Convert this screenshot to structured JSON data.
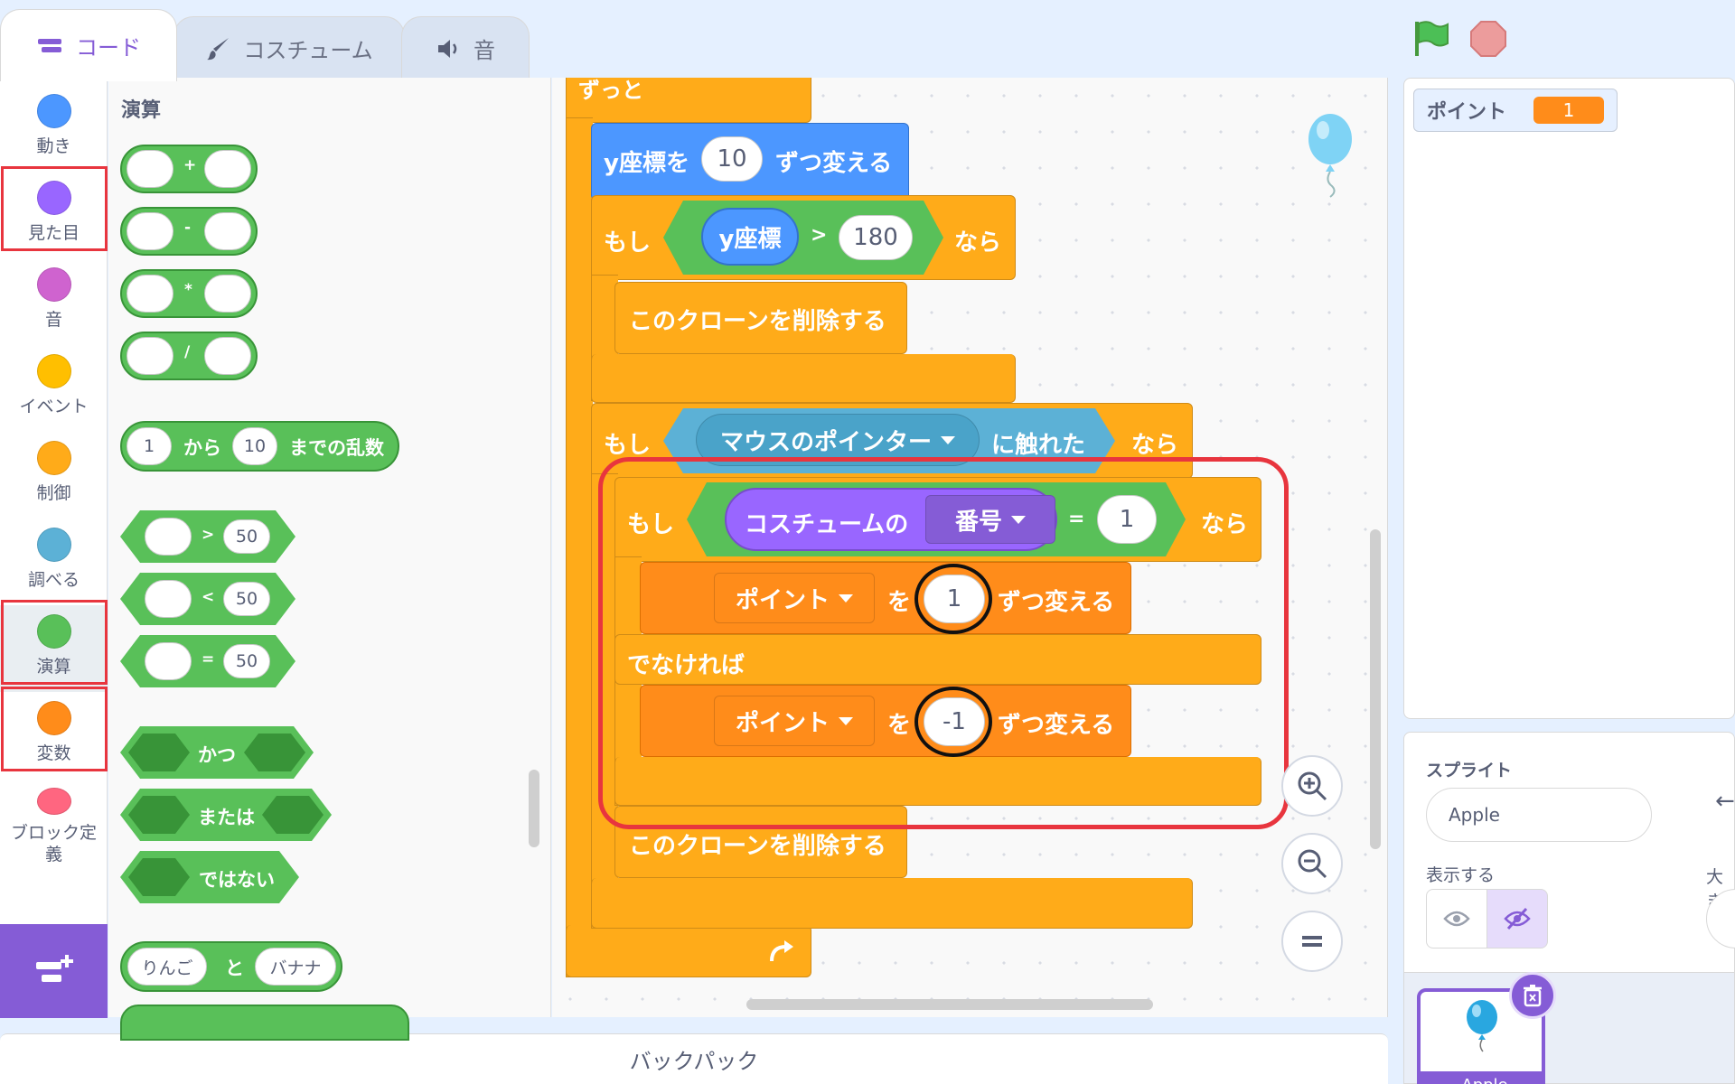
{
  "tabs": [
    {
      "label": "コード",
      "icon": "code-icon",
      "active": true
    },
    {
      "label": "コスチューム",
      "icon": "brush-icon",
      "active": false
    },
    {
      "label": "音",
      "icon": "speaker-icon",
      "active": false
    }
  ],
  "controls": {
    "green_flag": "green-flag-icon",
    "stop": "stop-icon"
  },
  "categories": [
    {
      "label": "動き",
      "color": "#4c97ff"
    },
    {
      "label": "見た目",
      "color": "#9966ff"
    },
    {
      "label": "音",
      "color": "#cf63cf"
    },
    {
      "label": "イベント",
      "color": "#ffbf00"
    },
    {
      "label": "制御",
      "color": "#ffab19"
    },
    {
      "label": "調べる",
      "color": "#5cb1d6"
    },
    {
      "label": "演算",
      "color": "#59c059"
    },
    {
      "label": "変数",
      "color": "#ff8c1a"
    },
    {
      "label": "ブロック定義",
      "color": "#ff6680"
    }
  ],
  "palette": {
    "title": "演算",
    "ops": [
      "+",
      "-",
      "*",
      "/"
    ],
    "random": {
      "from": "1",
      "word_from": "から",
      "to": "10",
      "word_to": "までの乱数"
    },
    "compare": [
      {
        "op": ">",
        "value": "50"
      },
      {
        "op": "<",
        "value": "50"
      },
      {
        "op": "=",
        "value": "50"
      }
    ],
    "logic": [
      "かつ",
      "または",
      "ではない"
    ],
    "join": {
      "a": "りんご",
      "word": "と",
      "b": "バナナ"
    }
  },
  "script": {
    "forever_label": "ずっと",
    "change_y": {
      "pre": "y座標を",
      "value": "10",
      "post": "ずつ変える"
    },
    "if1": {
      "word_if": "もし",
      "reporter": "y座標",
      "op": ">",
      "value": "180",
      "word_then": "なら"
    },
    "delete_clone": "このクローンを削除する",
    "if2": {
      "word_if": "もし",
      "touching": "マウスのポインター",
      "touched": "に触れた",
      "word_then": "なら"
    },
    "if3": {
      "word_if": "もし",
      "costume_of": "コスチュームの",
      "costume_field": "番号",
      "op": "=",
      "value": "1",
      "word_then": "なら"
    },
    "change_var1": {
      "var": "ポイント",
      "wo": "を",
      "value": "1",
      "post": "ずつ変える"
    },
    "else_label": "でなければ",
    "change_var2": {
      "var": "ポイント",
      "wo": "を",
      "value": "-1",
      "post": "ずつ変える"
    },
    "delete_clone2": "このクローンを削除する"
  },
  "stage": {
    "monitor_label": "ポイント",
    "monitor_value": "1"
  },
  "sprite_info": {
    "sprite_label": "スプライト",
    "sprite_name": "Apple",
    "show_label": "表示する",
    "size_label": "大き",
    "thumb_name": "Apple"
  },
  "backpack": "バックパック"
}
